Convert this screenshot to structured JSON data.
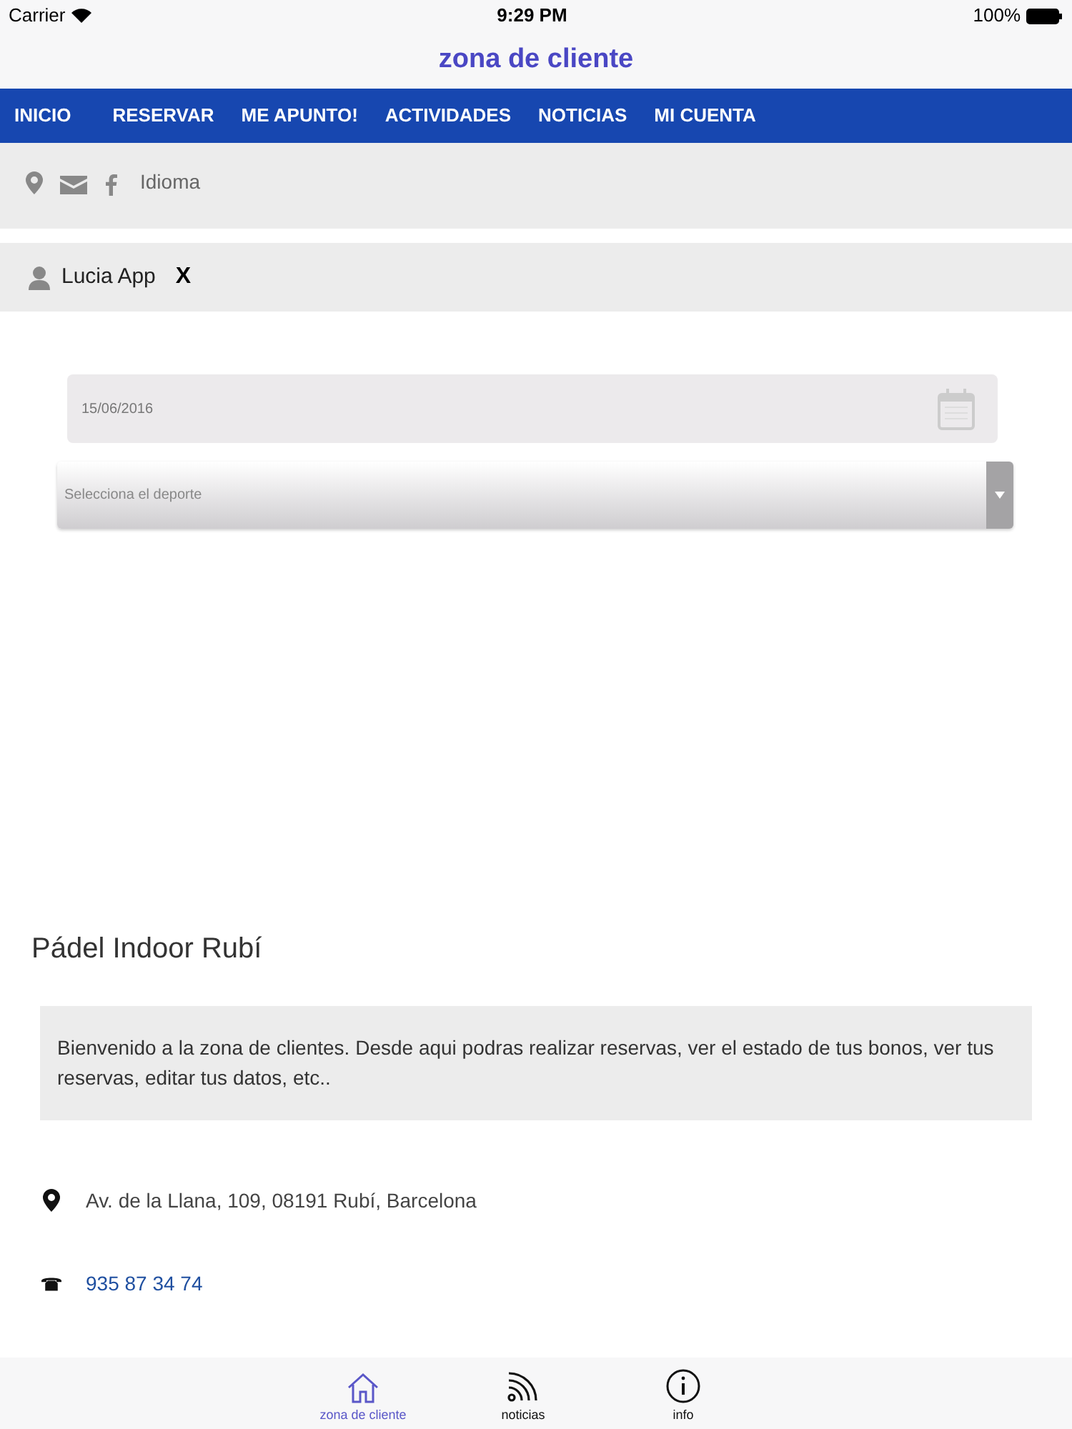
{
  "status_bar": {
    "carrier": "Carrier",
    "time": "9:29 PM",
    "battery": "100%"
  },
  "title": "zona de cliente",
  "nav": [
    "INICIO",
    "RESERVAR",
    "ME APUNTO!",
    "ACTIVIDADES",
    "NOTICIAS",
    "MI CUENTA"
  ],
  "top_links": {
    "language": "Idioma"
  },
  "user": {
    "name": "Lucia App",
    "close": "X"
  },
  "date_field": {
    "value": "15/06/2016"
  },
  "sport_select": {
    "placeholder": "Selecciona el deporte"
  },
  "club_name": "Pádel Indoor Rubí",
  "welcome": "Bienvenido a la zona de clientes. Desde aqui podras realizar reservas, ver el estado de tus bonos, ver tus reservas, editar tus datos, etc..",
  "contacts": [
    {
      "kind": "address",
      "text": "Av. de la Llana, 109, 08191 Rubí, Barcelona"
    },
    {
      "kind": "phone",
      "text": "935 87 34 74"
    }
  ],
  "tab_bar": [
    {
      "kind": "home",
      "label": "zona de cliente",
      "selected": true
    },
    {
      "kind": "rss",
      "label": "noticias",
      "selected": false
    },
    {
      "kind": "info",
      "label": "info",
      "selected": false
    }
  ]
}
